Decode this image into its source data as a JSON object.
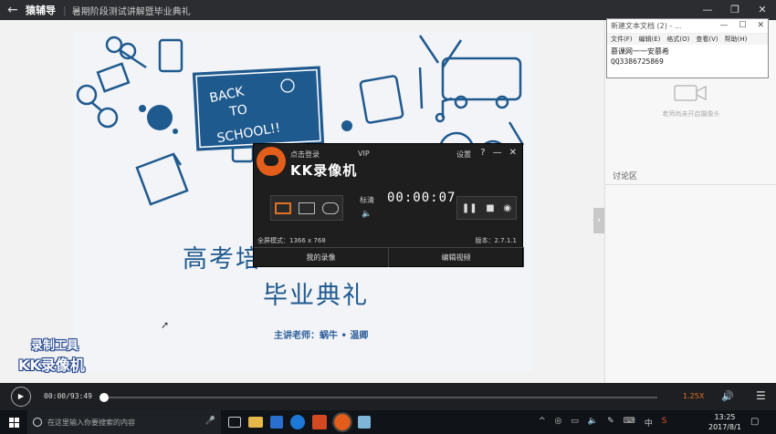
{
  "titlebar": {
    "brand": "猿辅导",
    "title": "暑期阶段测试讲解暨毕业典礼",
    "back": "←",
    "controls": [
      "—",
      "❐",
      "✕"
    ]
  },
  "slide": {
    "board_lines": [
      "BACK",
      "TO",
      "SCHOOL!!"
    ],
    "title_line1": "高考培",
    "title_line2": "毕业典礼",
    "teacher": "主讲老师：蜗牛 • 温卿"
  },
  "side": {
    "camera_text": "老师尚未开启摄像头",
    "discussion": "讨论区",
    "collapse": "›"
  },
  "notepad": {
    "title": "新建文本文档 (2) - ...",
    "menu": [
      "文件(F)",
      "编辑(E)",
      "格式(O)",
      "查看(V)",
      "帮助(H)"
    ],
    "lines": [
      "慕课网一一安慕希",
      "QQ3386725869"
    ],
    "controls": [
      "—",
      "☐",
      "✕"
    ]
  },
  "kk": {
    "login": "点击登录",
    "vip": "VIP",
    "settings": "设置",
    "controls": [
      "?",
      "—",
      "✕"
    ],
    "name": "KK录像机",
    "quality": "标清",
    "volume": "🔈",
    "timer": "00:00:07",
    "rec_buttons": [
      "❚❚",
      "■",
      "◉"
    ],
    "fullscreen": "全屏模式：1366 x 768",
    "version": "版本：2.7.1.1",
    "btn_my": "我的录像",
    "btn_edit": "编辑视频"
  },
  "watermark": {
    "line1": "录制工具",
    "line2": "KK录像机"
  },
  "player": {
    "play": "▶",
    "time": "00:00/93:49",
    "progress": 0,
    "speed": "1.25X",
    "volume_icon": "🔊",
    "menu_icon": "☰"
  },
  "taskbar": {
    "search_placeholder": "在这里输入你要搜索的内容",
    "mic": "🎤",
    "tray": [
      "^",
      "◎",
      "▭",
      "🔈",
      "✎",
      "⌨",
      "中",
      "S"
    ],
    "time": "13:25",
    "date": "2017/8/1",
    "notif": "▢"
  },
  "colors": {
    "accent": "#e37324",
    "slide_blue": "#1f5a8f",
    "dark": "#1e1f22"
  }
}
